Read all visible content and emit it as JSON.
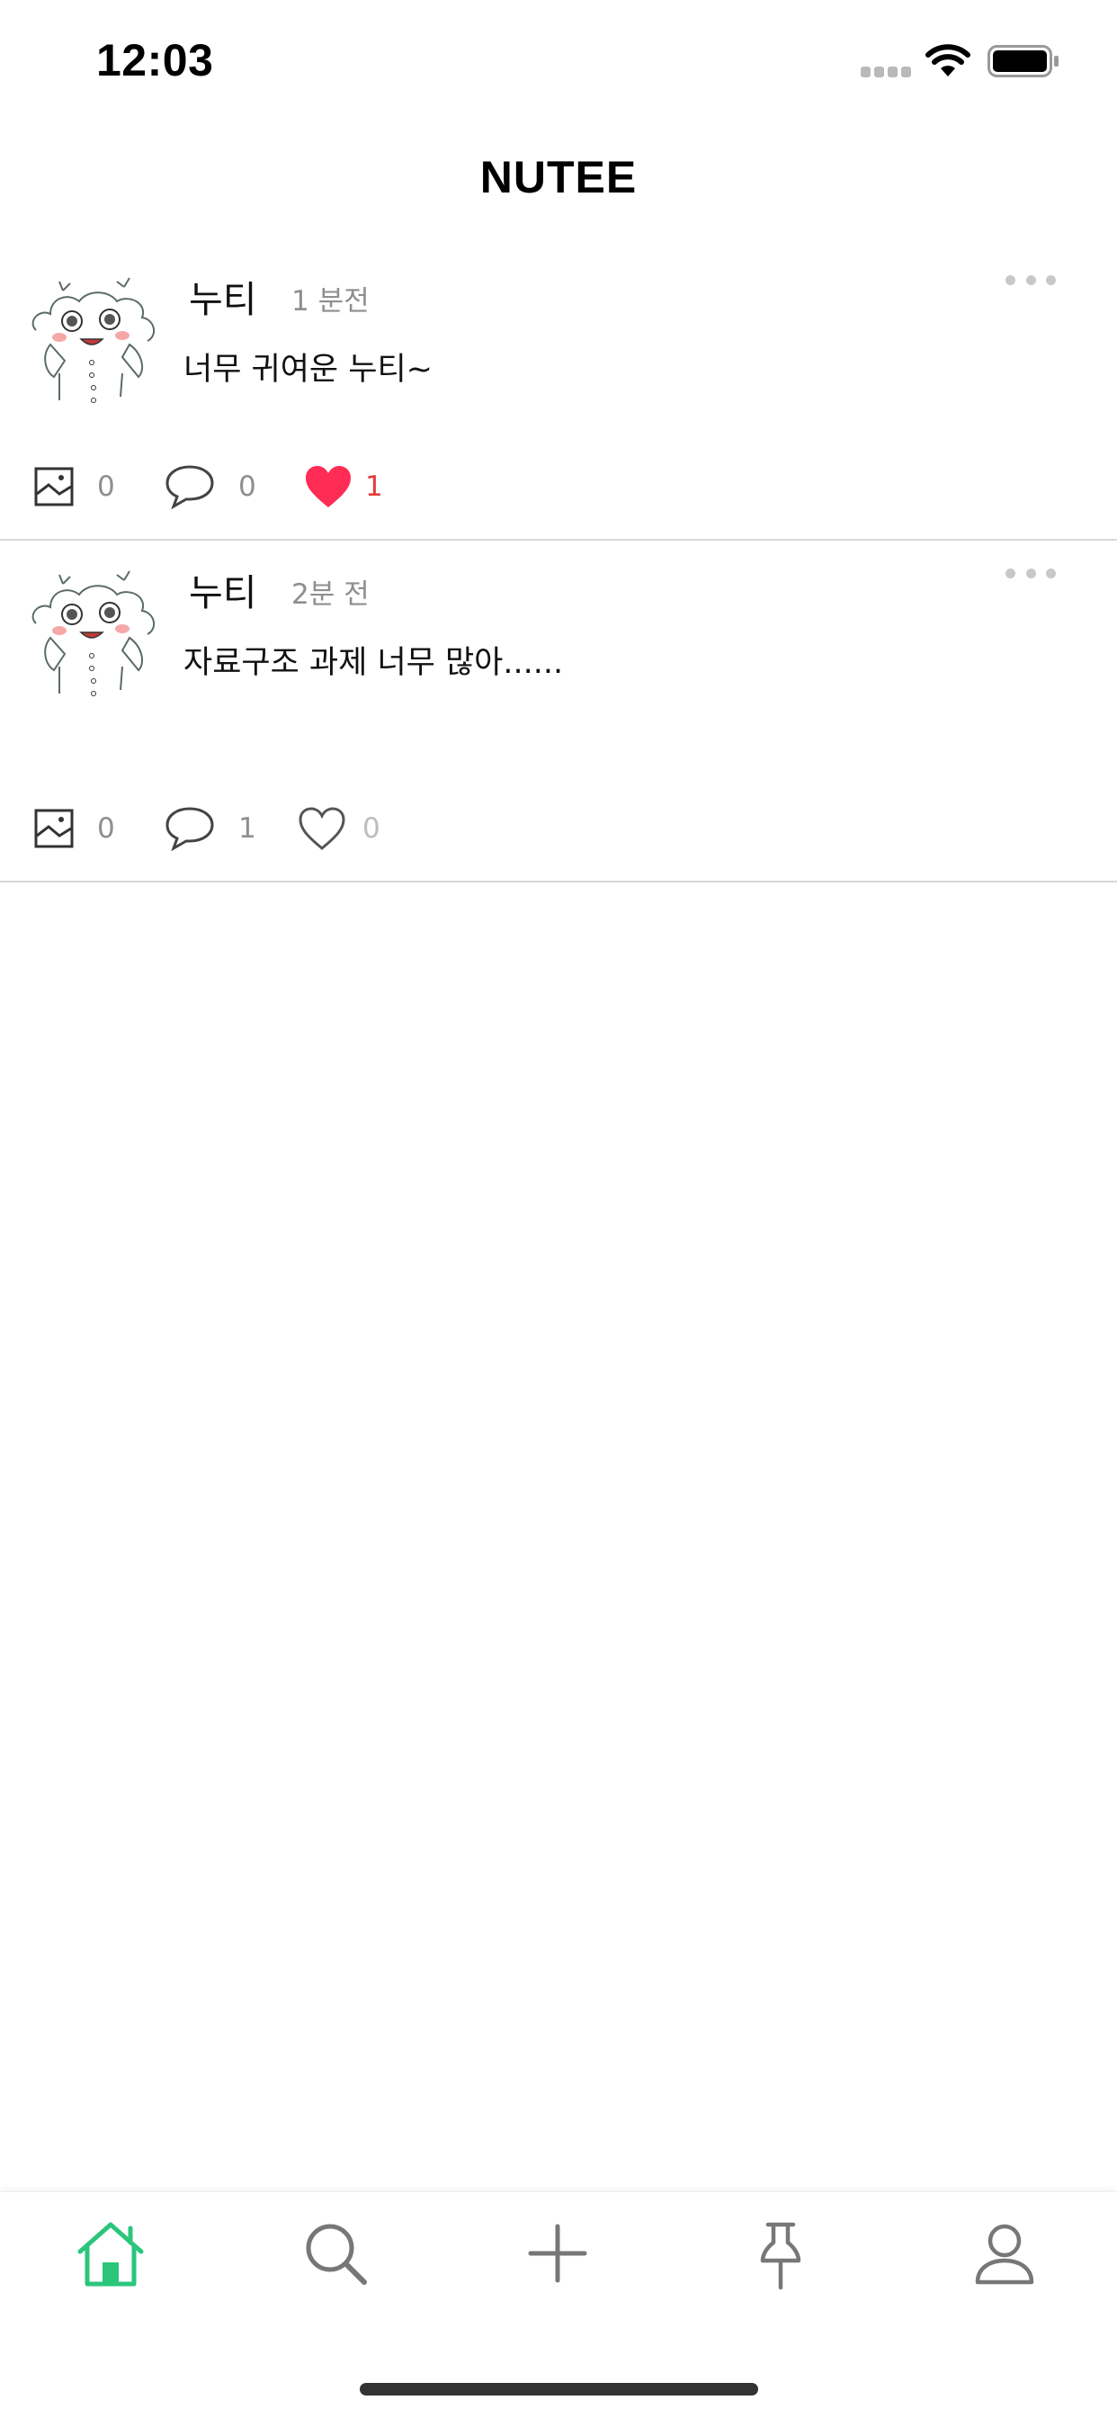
{
  "status_bar": {
    "time": "12:03",
    "icons": [
      "signal-dots-icon",
      "wifi-icon",
      "battery-icon"
    ]
  },
  "nav": {
    "title": "NUTEE"
  },
  "theme": {
    "accent": "#2bc57c",
    "like_color": "#ff2d55",
    "like_count_color": "#e23b3b",
    "muted_text": "#8e8e8e",
    "divider": "#d8d8d8"
  },
  "posts": [
    {
      "author": "누티",
      "time": "1 분전",
      "body": "너무 귀여운 누티~",
      "images": "0",
      "comments": "0",
      "likes": "1",
      "liked": true
    },
    {
      "author": "누티",
      "time": "2분 전",
      "body": "자료구조 과제 너무 많아......",
      "images": "0",
      "comments": "1",
      "likes": "0",
      "liked": false
    }
  ],
  "tab_bar": {
    "active": "home",
    "tabs": [
      "home-icon",
      "search-icon",
      "plus-icon",
      "pin-icon",
      "profile-icon"
    ]
  }
}
